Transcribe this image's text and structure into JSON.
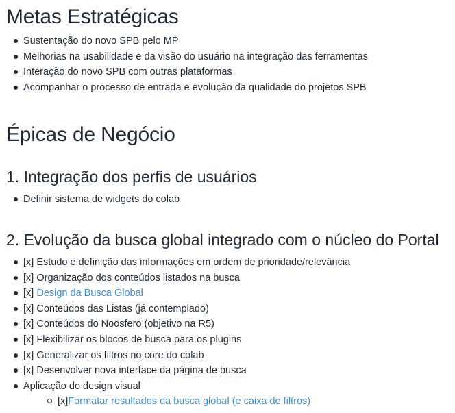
{
  "metas": {
    "title": "Metas Estratégicas",
    "items": [
      "Sustentação do novo SPB pelo MP",
      "Melhorias na usabilidade e da visão do usuário na integração das ferramentas",
      "Interação do novo SPB com outras plataformas",
      "Acompanhar o processo de entrada e evolução da qualidade do projetos SPB"
    ]
  },
  "epicas": {
    "title": "Épicas de Negócio",
    "section1": {
      "title": "1. Integração dos perfis de usuários",
      "items": [
        "Definir sistema de widgets do colab"
      ]
    },
    "section2": {
      "title": "2. Evolução da busca global integrado com o núcleo do Portal",
      "items": [
        {
          "prefix": "[x] ",
          "text": "Estudo e definição das informações em ordem de prioridade/relevância"
        },
        {
          "prefix": "[x] ",
          "text": "Organização dos conteúdos listados na busca"
        },
        {
          "prefix": "[x] ",
          "link": "Design da Busca Global"
        },
        {
          "prefix": "[x] ",
          "text": "Conteúdos das Listas (já contemplado)"
        },
        {
          "prefix": "[x] ",
          "text": "Conteúdos do Noosfero (objetivo na R5)"
        },
        {
          "prefix": "[x] ",
          "text": "Flexibilizar os blocos de busca para os plugins"
        },
        {
          "prefix": "[x] ",
          "text": "Generalizar os filtros no core do colab"
        },
        {
          "prefix": "[x] ",
          "text": "Desenvolver nova interface da página de busca"
        },
        {
          "text": "Aplicação do design visual"
        }
      ],
      "subitems": [
        {
          "prefix": "[x]",
          "link": "Formatar resultados da busca global (e caixa de filtros)"
        }
      ]
    }
  },
  "colors": {
    "text": "#1f2a36",
    "link": "#3b8ed6"
  }
}
